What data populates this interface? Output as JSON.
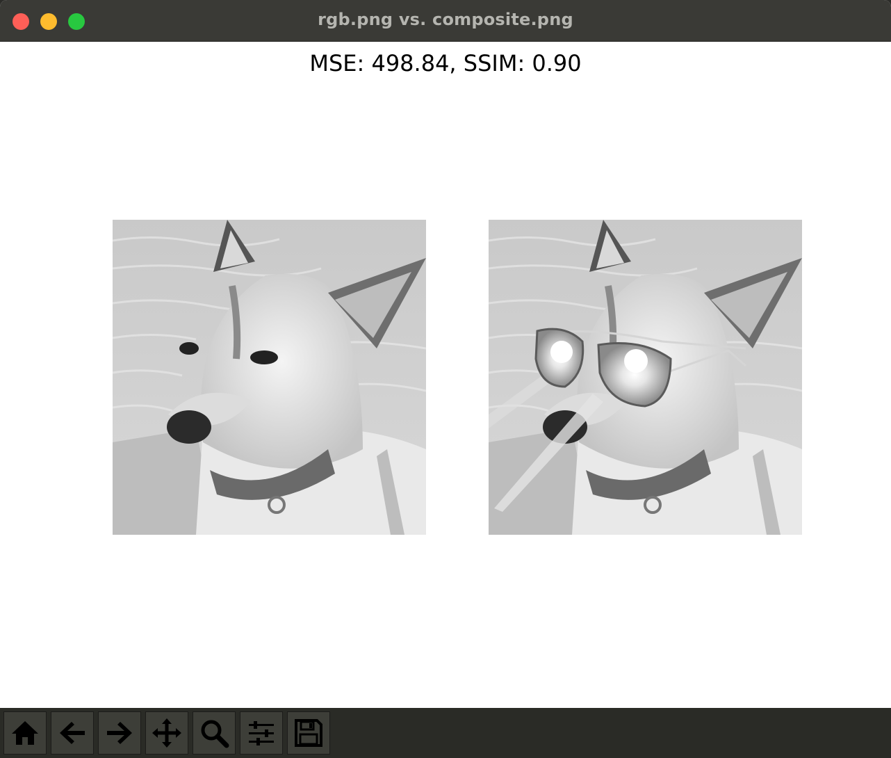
{
  "window": {
    "title": "rgb.png vs. composite.png"
  },
  "figure": {
    "title": "MSE: 498.84, SSIM: 0.90"
  },
  "images": [
    {
      "name": "rgb",
      "subject": "grayscale dog portrait"
    },
    {
      "name": "composite",
      "subject": "grayscale dog portrait with aviator sunglasses"
    }
  ],
  "toolbar": {
    "buttons": [
      {
        "id": "home",
        "icon": "home-icon"
      },
      {
        "id": "back",
        "icon": "arrow-left-icon"
      },
      {
        "id": "forward",
        "icon": "arrow-right-icon"
      },
      {
        "id": "pan",
        "icon": "move-icon"
      },
      {
        "id": "zoom",
        "icon": "magnifier-icon"
      },
      {
        "id": "configure",
        "icon": "sliders-icon"
      },
      {
        "id": "save",
        "icon": "floppy-disk-icon"
      }
    ]
  },
  "colors": {
    "titlebar": "#3a3a36",
    "toolbar": "#2a2b26",
    "close": "#fe5f57",
    "minimize": "#febc2e",
    "maximize": "#28c840"
  }
}
